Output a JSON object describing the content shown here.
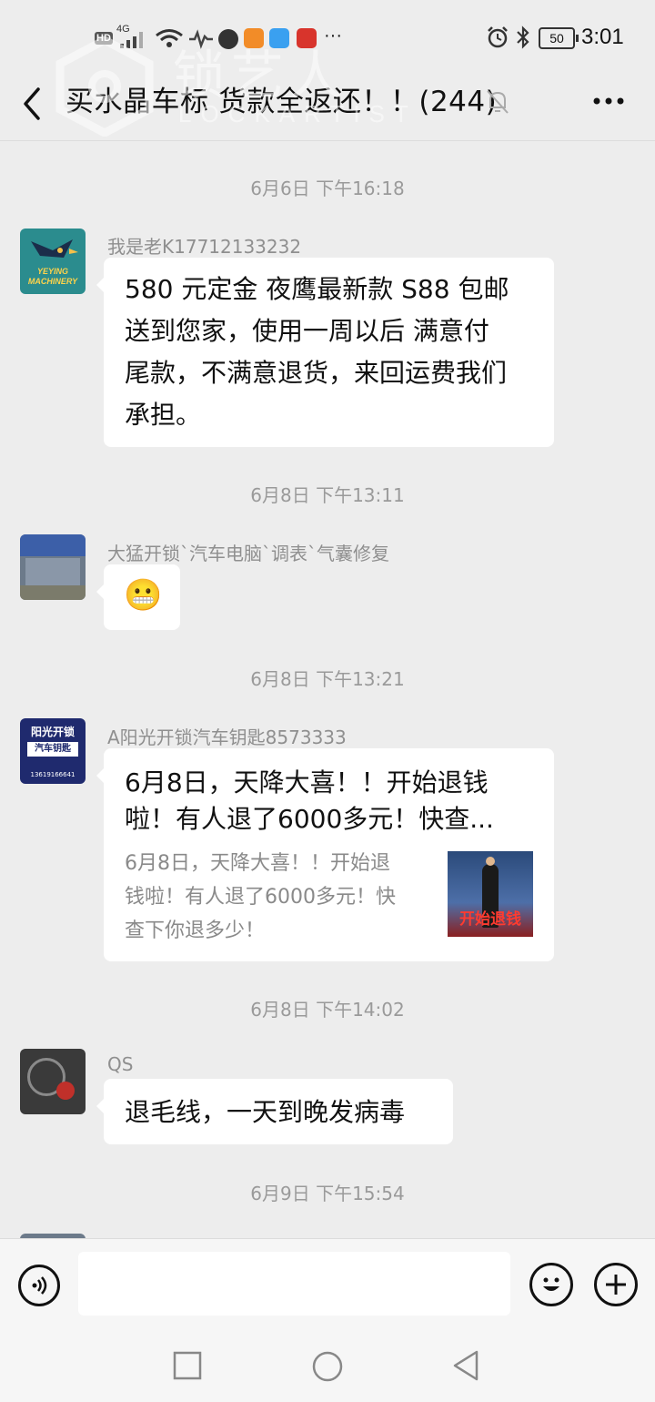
{
  "status_bar": {
    "network_badge": "HD",
    "network_type": "4G",
    "more_indicator": "···",
    "battery_level": "50",
    "time": "3:01",
    "icons": [
      "signal-icon",
      "wifi-icon",
      "activity-icon",
      "app-icon",
      "app-icon",
      "app-icon",
      "app-icon",
      "alarm-icon",
      "bluetooth-icon",
      "battery-icon"
    ]
  },
  "header": {
    "title": "买水晶车标 货款全返还！！(244)",
    "watermark": "锁艺人",
    "watermark_sub": "LOCKARTIST",
    "icons": [
      "back-icon",
      "mute-icon",
      "more-icon"
    ]
  },
  "messages": [
    {
      "type": "time",
      "text": "6月6日 下午16:18"
    },
    {
      "type": "msg",
      "sender": "我是老K17712133232",
      "avatar_text": [
        "YEYING",
        "MACHINERY"
      ],
      "lines": [
        "580 元定金 夜鹰最新款 S88 包邮",
        "送到您家，使用一周以后 满意付",
        "尾款，不满意退货，来回运费我们",
        "承担。"
      ]
    },
    {
      "type": "time",
      "text": "6月8日 下午13:11"
    },
    {
      "type": "msg",
      "sender": "大猛开锁`汽车电脑`调表`气囊修复",
      "emoji": "😬"
    },
    {
      "type": "time",
      "text": "6月8日 下午13:21"
    },
    {
      "type": "link",
      "sender": "A阳光开锁汽车钥匙8573333",
      "avatar_text": [
        "阳光开锁",
        "汽车钥匙",
        "13619166641"
      ],
      "title_lines": [
        "6月8日，天降大喜！！开始退钱",
        "啦！有人退了6000多元！快查..."
      ],
      "desc_lines": [
        "6月8日，天降大喜！！开始退",
        "钱啦！有人退了6000多元！快",
        "查下你退多少！"
      ],
      "thumb_caption": "开始退钱"
    },
    {
      "type": "time",
      "text": "6月8日 下午14:02"
    },
    {
      "type": "msg",
      "sender": "QS",
      "lines": [
        "退毛线，一天到晚发病毒"
      ]
    },
    {
      "type": "time",
      "text": "6月9日 下午15:54"
    }
  ],
  "input_bar": {
    "placeholder": "",
    "icons": [
      "voice-icon",
      "emoji-icon",
      "plus-icon"
    ]
  },
  "nav_bar": {
    "icons": [
      "recent-apps-icon",
      "home-icon",
      "back-nav-icon"
    ]
  },
  "colors": {
    "background": "#ededed",
    "bubble": "#ffffff",
    "timestamp": "#9a9a9a",
    "sender": "#8f8f8f"
  }
}
